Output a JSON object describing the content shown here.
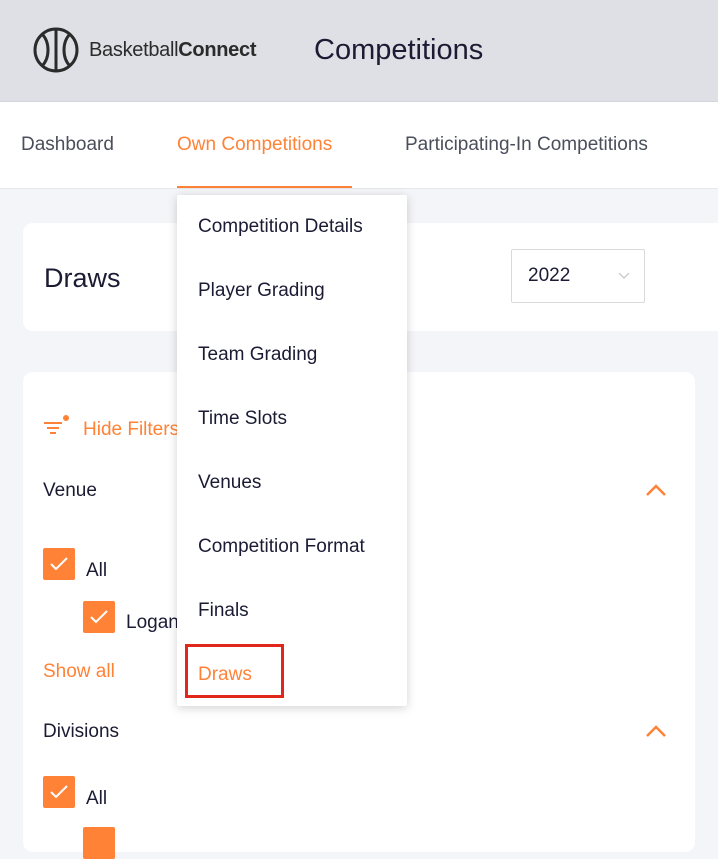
{
  "header": {
    "brand_regular": "Basketball",
    "brand_bold": "Connect",
    "page_title": "Competitions"
  },
  "nav": {
    "tabs": [
      {
        "label": "Dashboard",
        "active": false
      },
      {
        "label": "Own Competitions",
        "active": true
      },
      {
        "label": "Participating-In Competitions",
        "active": false
      }
    ]
  },
  "draws": {
    "title": "Draws",
    "year_select": {
      "value": "2022"
    }
  },
  "filters": {
    "hide_label": "Hide Filters",
    "venue": {
      "title": "Venue",
      "all_label": "All",
      "all_checked": true,
      "items": [
        {
          "label": "Logan",
          "checked": true
        }
      ],
      "show_all": "Show all"
    },
    "divisions": {
      "title": "Divisions",
      "all_label": "All",
      "all_checked": true
    }
  },
  "dropdown": {
    "items": [
      "Competition Details",
      "Player Grading",
      "Team Grading",
      "Time Slots",
      "Venues",
      "Competition Format",
      "Finals",
      "Draws"
    ],
    "selected": "Draws"
  },
  "colors": {
    "accent": "#ff8237",
    "highlight": "#e1261c",
    "header_bg": "#dfe0e5",
    "page_bg": "#f4f5f8",
    "text": "#1b1b34"
  }
}
